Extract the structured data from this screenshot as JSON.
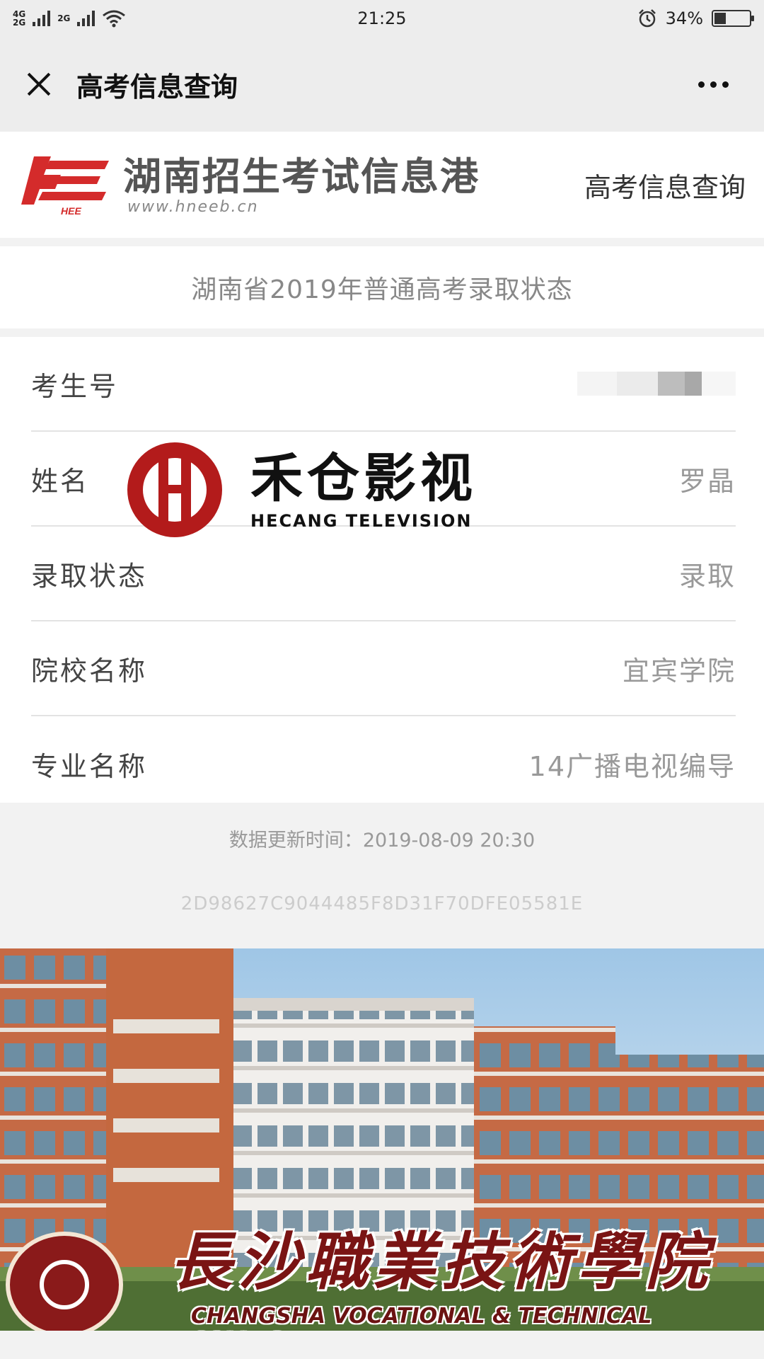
{
  "status_bar": {
    "network_top": "4G",
    "network_bottom": "2G",
    "network_mid": "2G",
    "time": "21:25",
    "battery": "34%",
    "battery_level": 0.34
  },
  "nav": {
    "title": "高考信息查询"
  },
  "site": {
    "logo_badge": "HEE",
    "name": "湖南招生考试信息港",
    "url": "www.hneeb.cn",
    "header_link": "高考信息查询",
    "brand_color": "#d42b2b"
  },
  "query": {
    "title": "湖南省2019年普通高考录取状态"
  },
  "rows": [
    {
      "label": "考生号",
      "value": ""
    },
    {
      "label": "姓名",
      "value": "罗晶"
    },
    {
      "label": "录取状态",
      "value": "录取"
    },
    {
      "label": "院校名称",
      "value": "宜宾学院"
    },
    {
      "label": "专业名称",
      "value": "14广播电视编导"
    }
  ],
  "watermark": {
    "cn": "禾仓影视",
    "en": "HECANG TELEVISION",
    "color": "#b31b1b"
  },
  "update_time": "数据更新时间：2019-08-09 20:30",
  "hash": "2D98627C9044485F8D31F70DFE05581E",
  "banner": {
    "college_cn": "長沙職業技術學院",
    "college_en": "CHANGSHA VOCATIONAL & TECHNICAL COLLEGE"
  }
}
